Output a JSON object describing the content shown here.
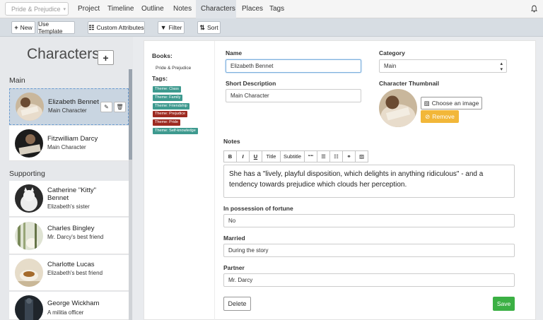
{
  "topnav": {
    "series_select": "Pride & Prejudice",
    "items": [
      {
        "label": "Project"
      },
      {
        "label": "Timeline"
      },
      {
        "label": "Outline"
      },
      {
        "label": "Notes"
      },
      {
        "label": "Characters",
        "active": true
      },
      {
        "label": "Places"
      },
      {
        "label": "Tags"
      }
    ],
    "bell_icon": "bell-icon"
  },
  "toolbar": {
    "new_label": "New",
    "use_template_label": "Use Template",
    "custom_attributes_label": "Custom Attributes",
    "filter_label": "Filter",
    "sort_label": "Sort"
  },
  "sidebar": {
    "title": "Characters",
    "add_symbol": "+",
    "sections": [
      {
        "label": "Main",
        "characters": [
          {
            "name": "Elizabeth Bennet",
            "description": "Main Character",
            "selected": true
          },
          {
            "name": "Fitzwilliam Darcy",
            "description": "Main Character"
          }
        ]
      },
      {
        "label": "Supporting",
        "characters": [
          {
            "name": "Catherine \"Kitty\" Bennet",
            "description": "Elizabeth's sister"
          },
          {
            "name": "Charles Bingley",
            "description": "Mr. Darcy's best friend"
          },
          {
            "name": "Charlotte Lucas",
            "description": "Elizabeth's best friend"
          },
          {
            "name": "George Wickham",
            "description": "A militia officer"
          }
        ]
      }
    ]
  },
  "editor": {
    "books_label": "Books:",
    "books": [
      "Pride & Prejudice"
    ],
    "tags_label": "Tags:",
    "tags": [
      {
        "label": "Theme: Class",
        "color": "#3e9a8f"
      },
      {
        "label": "Theme: Family",
        "color": "#3e9a8f"
      },
      {
        "label": "Theme: Friendship",
        "color": "#3e9a8f"
      },
      {
        "label": "Theme: Prejudice",
        "color": "#9d2a21"
      },
      {
        "label": "Theme: Pride",
        "color": "#9d2a21"
      },
      {
        "label": "Theme: Self-knowledge",
        "color": "#3e9a8f"
      }
    ],
    "name_label": "Name",
    "name_value": "Elizabeth Bennet",
    "short_desc_label": "Short Description",
    "short_desc_value": "Main Character",
    "category_label": "Category",
    "category_value": "Main",
    "thumbnail_label": "Character Thumbnail",
    "choose_image_label": "Choose an image",
    "remove_label": "Remove",
    "notes_label": "Notes",
    "notes_toolbar": {
      "bold": "B",
      "italic": "I",
      "underline": "U",
      "title": "Title",
      "subtitle": "Subtitle",
      "quote": "““"
    },
    "notes_text": "She has a \"lively, playful disposition, which delights in anything ridiculous\" - and a tendency towards prejudice which clouds her perception.",
    "fortune_label": "In possession of fortune",
    "fortune_value": "No",
    "married_label": "Married",
    "married_value": "During the story",
    "partner_label": "Partner",
    "partner_value": "Mr. Darcy",
    "delete_label": "Delete",
    "save_label": "Save"
  }
}
